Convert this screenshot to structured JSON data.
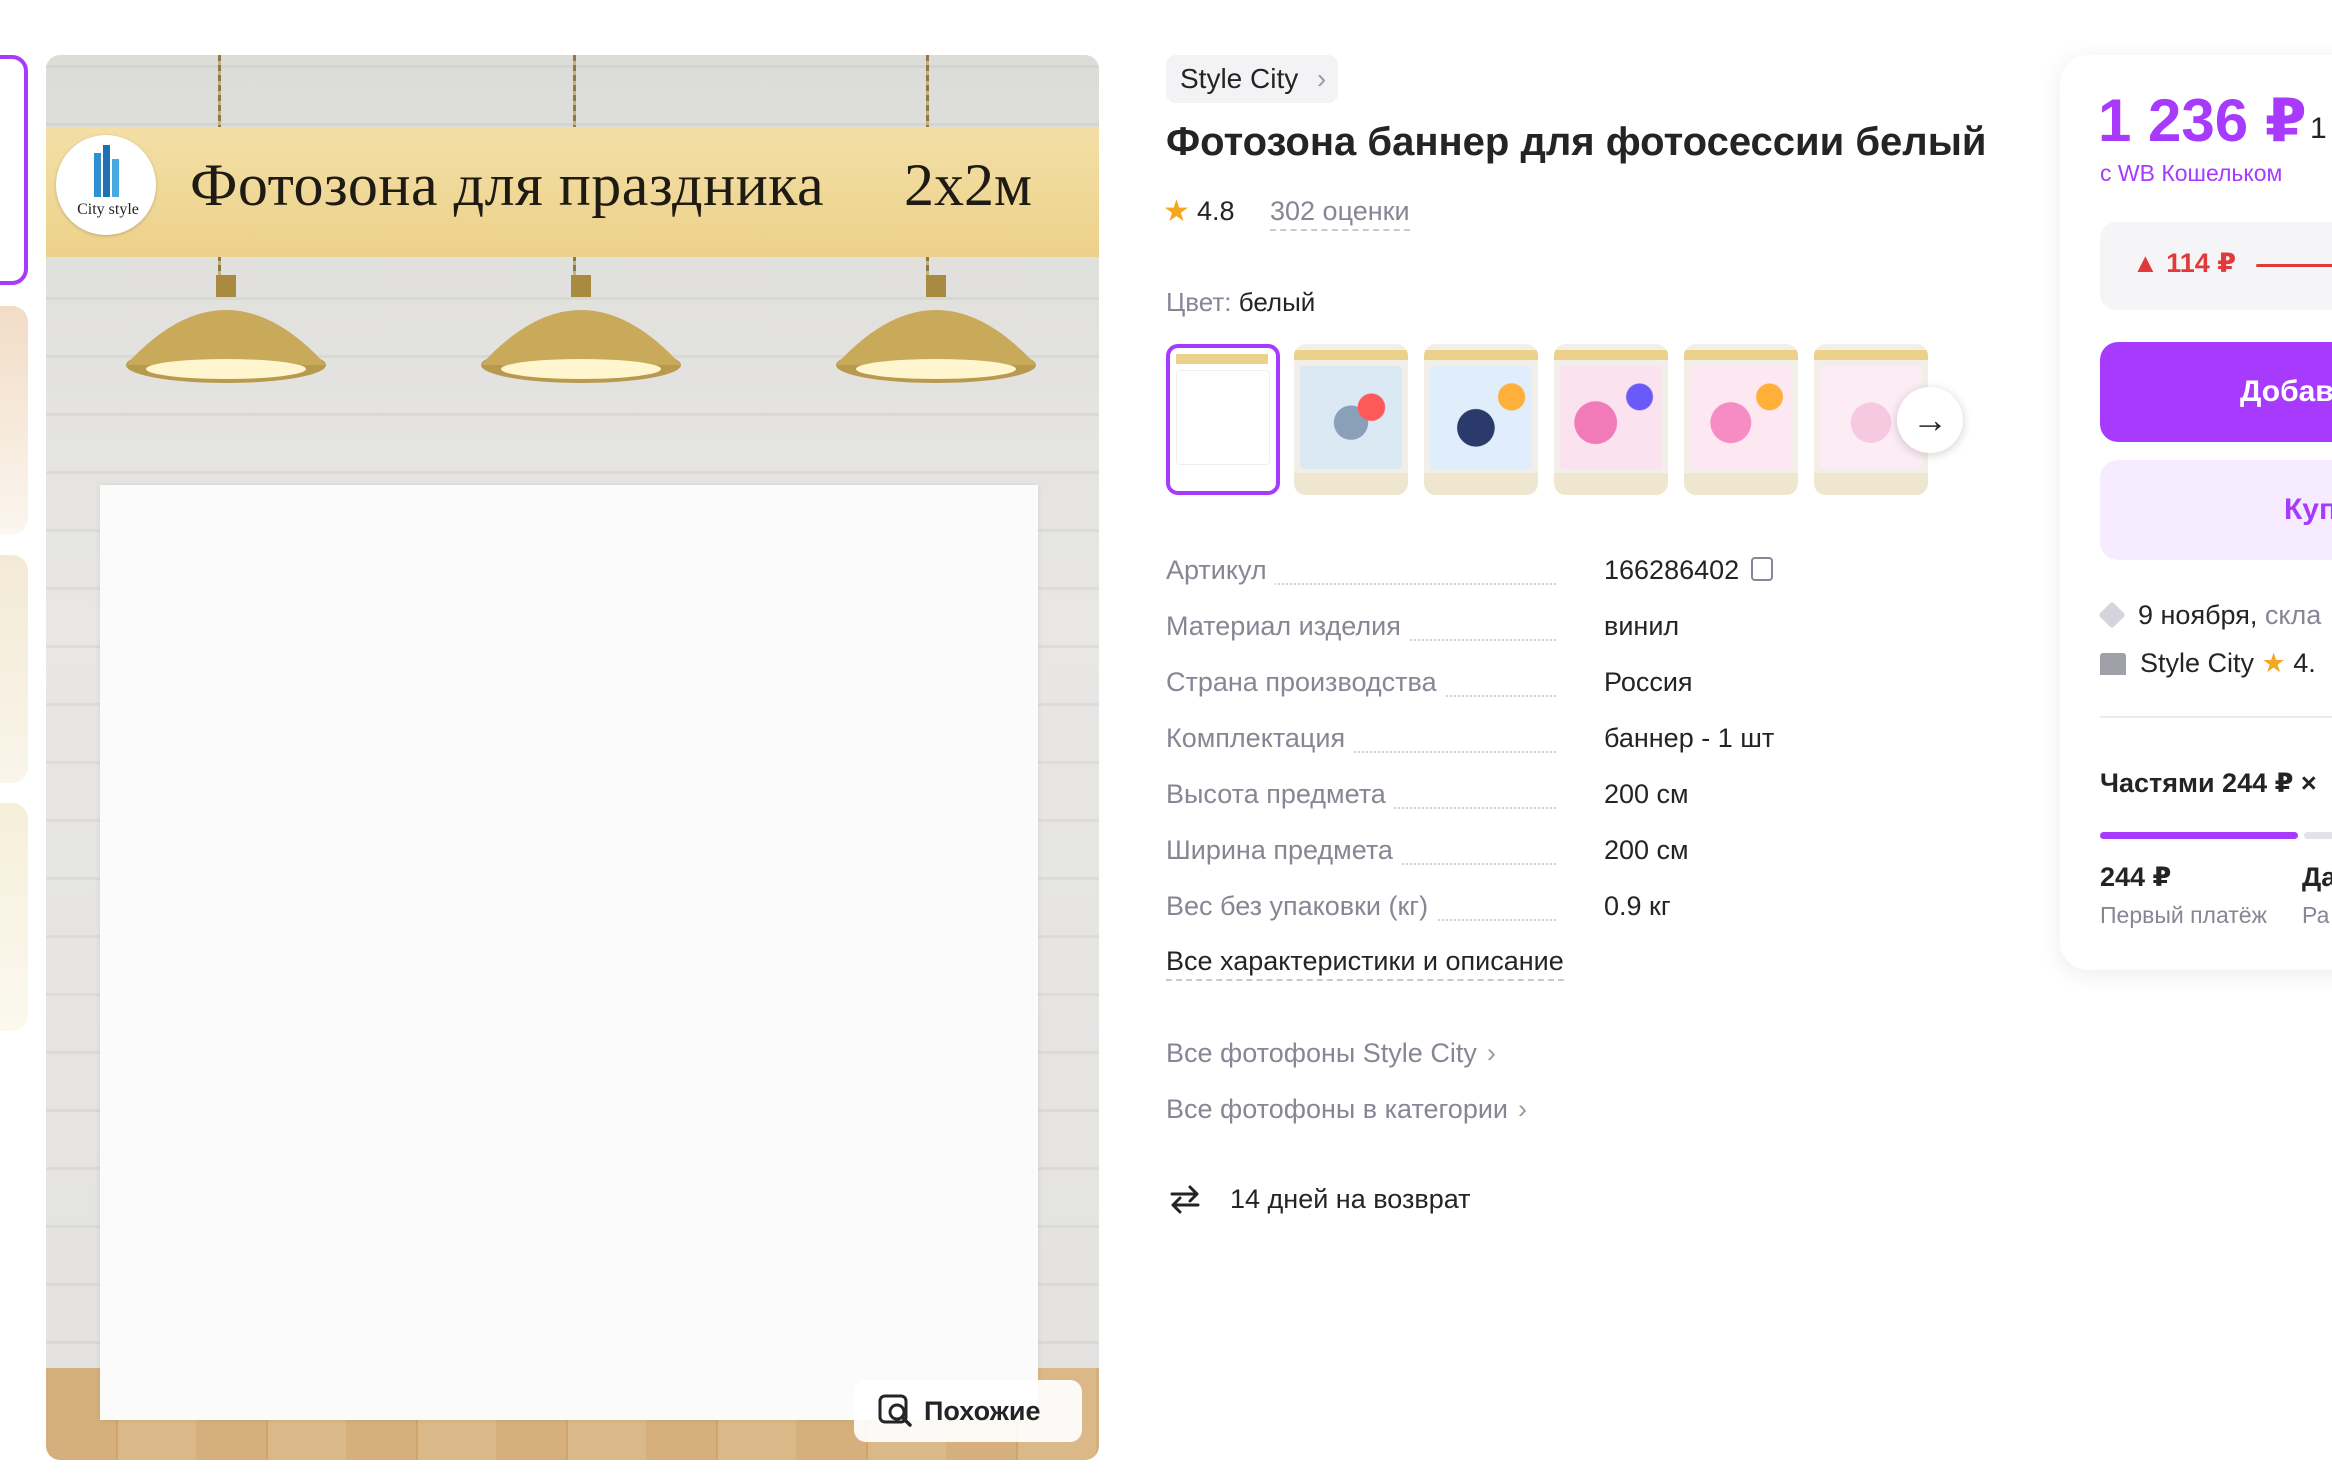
{
  "gallery": {
    "thumbs": [
      "thumb-1",
      "thumb-2",
      "thumb-3",
      "thumb-4"
    ],
    "banner_title": "Фотозона для праздника",
    "banner_size": "2х2м",
    "logo_text": "City style",
    "similar_label": "Похожие"
  },
  "product": {
    "brand": "Style City",
    "title": "Фотозона баннер для фотосессии белый",
    "rating": "4.8",
    "rating_count": "302 оценки",
    "color_label": "Цвет:",
    "color_value": "белый",
    "specs": [
      {
        "key": "Артикул",
        "value": "166286402"
      },
      {
        "key": "Материал изделия",
        "value": "винил"
      },
      {
        "key": "Страна производства",
        "value": "Россия"
      },
      {
        "key": "Комплектация",
        "value": "баннер - 1 шт"
      },
      {
        "key": "Высота предмета",
        "value": "200 см"
      },
      {
        "key": "Ширина предмета",
        "value": "200 см"
      },
      {
        "key": "Вес без упаковки (кг)",
        "value": "0.9 кг"
      }
    ],
    "all_specs_link": "Все характеристики и описание",
    "links": [
      "Все фотофоны Style City",
      "Все фотофоны в категории"
    ],
    "return_text": "14 дней на возврат"
  },
  "buy_box": {
    "price": "1 236 ₽",
    "price_old_partial": "1",
    "wallet_label": "с WB Кошельком",
    "price_delta": "114 ₽",
    "add_button_partial": "Добав",
    "buy_button_partial": "Куп",
    "delivery_date": "9 ноября,",
    "delivery_rest": "скла",
    "seller_name": "Style City",
    "seller_rating_partial": "4.",
    "installments_title": "Частями 244 ₽ ×",
    "first_payment_value": "244 ₽",
    "first_payment_label": "Первый платёж",
    "second_value_partial": "Да",
    "second_label_partial": "Ра"
  },
  "colors": {
    "accent": "#a73afd",
    "price_up": "#e13a3a",
    "star": "#f5a623"
  }
}
